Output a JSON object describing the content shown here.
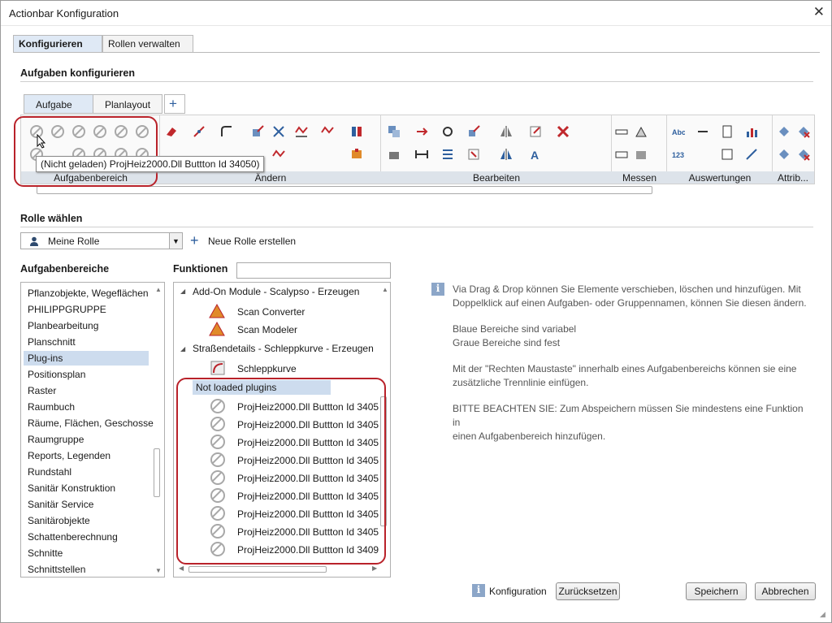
{
  "window": {
    "title": "Actionbar Konfiguration",
    "close": "✕"
  },
  "main_tabs": [
    {
      "label": "Konfigurieren"
    },
    {
      "label": "Rollen verwalten"
    }
  ],
  "config_section": {
    "title": "Aufgaben konfigurieren"
  },
  "task_tabs": [
    {
      "label": "Aufgabe"
    },
    {
      "label": "Planlayout"
    },
    {
      "label": "+"
    }
  ],
  "toolbar": {
    "groups": [
      {
        "label": "Aufgabenbereich"
      },
      {
        "label": "Ändern"
      },
      {
        "label": "Bearbeiten"
      },
      {
        "label": "Messen"
      },
      {
        "label": "Auswertungen"
      },
      {
        "label": "Attrib..."
      }
    ]
  },
  "tooltip": {
    "text": "(Nicht geladen) ProjHeiz2000.Dll Buttton Id 34050)"
  },
  "role_section": {
    "title": "Rolle wählen",
    "selected_role": "Meine Rolle",
    "new_role": "Neue Rolle erstellen"
  },
  "areas": {
    "title": "Aufgabenbereiche",
    "items": [
      "Pflanzobjekte, Wegeflächen",
      "PHILIPPGRUPPE",
      "Planbearbeitung",
      "Planschnitt",
      "Plug-ins",
      "Positionsplan",
      "Raster",
      "Raumbuch",
      "Räume, Flächen, Geschosse",
      "Raumgruppe",
      "Reports, Legenden",
      "Rundstahl",
      "Sanitär Konstruktion",
      "Sanitär Service",
      "Sanitärobjekte",
      "Schattenberechnung",
      "Schnitte",
      "Schnittstellen"
    ],
    "selected": "Plug-ins"
  },
  "functions": {
    "title": "Funktionen",
    "groups": [
      {
        "title": "Add-On Module - Scalypso - Erzeugen",
        "items": [
          "Scan Converter",
          "Scan Modeler"
        ]
      },
      {
        "title": "Straßendetails - Schleppkurve - Erzeugen",
        "items": [
          "Schleppkurve"
        ]
      }
    ],
    "not_loaded": {
      "title": "Not loaded plugins",
      "items": [
        "ProjHeiz2000.Dll Buttton Id 3405",
        "ProjHeiz2000.Dll Buttton Id 3405",
        "ProjHeiz2000.Dll Buttton Id 3405",
        "ProjHeiz2000.Dll Buttton Id 3405",
        "ProjHeiz2000.Dll Buttton Id 3405",
        "ProjHeiz2000.Dll Buttton Id 3405",
        "ProjHeiz2000.Dll Buttton Id 3405",
        "ProjHeiz2000.Dll Buttton Id 3405",
        "ProjHeiz2000.Dll Buttton Id 3409"
      ]
    }
  },
  "info": {
    "p1": "Via Drag & Drop können Sie Elemente verschieben, löschen und hinzufügen. Mit",
    "p1b": "Doppelklick auf einen Aufgaben- oder Gruppennamen, können Sie diesen ändern.",
    "p2": "Blaue Bereiche sind variabel",
    "p2b": "Graue Bereiche sind fest",
    "p3": "Mit der \"Rechten Maustaste\" innerhalb eines Aufgabenbereichs können sie eine",
    "p3b": "zusätzliche Trennlinie einfügen.",
    "p4": "BITTE BEACHTEN SIE: Zum Abspeichern müssen Sie mindestens eine Funktion in",
    "p4b": "einen Aufgabenbereich hinzufügen."
  },
  "footer": {
    "config_label": "Konfiguration",
    "reset": "Zurücksetzen",
    "save": "Speichern",
    "cancel": "Abbrechen"
  },
  "colors": {
    "accent": "#2e5f9e",
    "callout": "#b9222a",
    "selection": "#cddcee"
  }
}
